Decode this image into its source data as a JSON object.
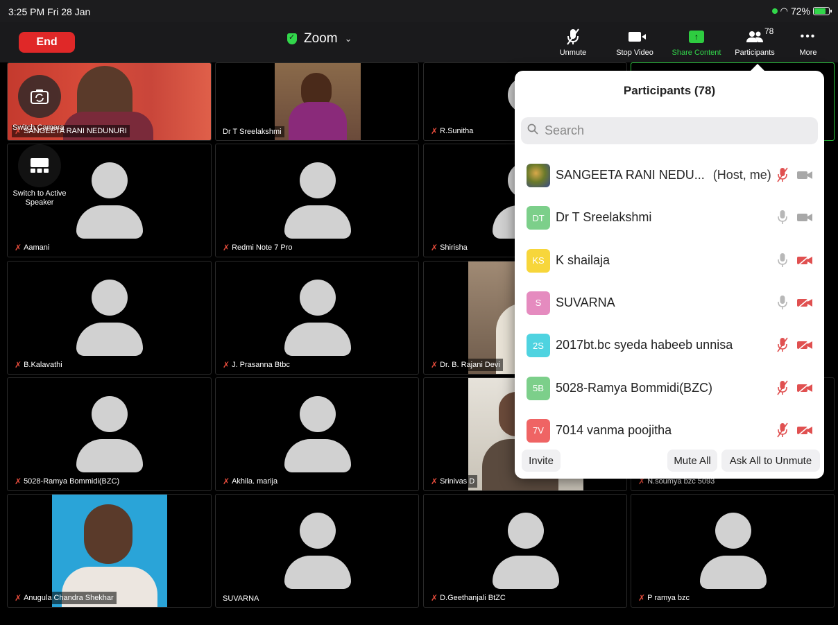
{
  "status_bar": {
    "time": "3:25 PM  Fri 28 Jan",
    "battery": "72%"
  },
  "toolbar": {
    "end_label": "End",
    "meeting_title": "Zoom",
    "unmute_label": "Unmute",
    "stop_video_label": "Stop Video",
    "share_label": "Share Content",
    "participants_label": "Participants",
    "participants_count": "78",
    "more_label": "More"
  },
  "controls": {
    "switch_camera_label": "Switch Camera",
    "switch_speaker_label": "Switch to Active Speaker"
  },
  "tiles": [
    "SANGEETA RANI NEDUNURI",
    "Dr T Sreelakshmi",
    "R.Sunitha",
    "Aamani",
    "Redmi Note 7 Pro",
    "Shirisha",
    "B.Kalavathi",
    "J. Prasanna Btbc",
    "Dr. B. Rajani Devi",
    "5028-Ramya Bommidi(BZC)",
    "Akhila. marija",
    "Srinivas D",
    "N.soumya bzc 5093",
    "Anugula Chandra Shekhar",
    "SUVARNA",
    "D.Geethanjali BtZC",
    "P ramya bzc"
  ],
  "panel": {
    "title": "Participants (78)",
    "search_placeholder": "Search",
    "participants": [
      {
        "initials": "",
        "name": "SANGEETA RANI NEDU...",
        "tag": "(Host, me)",
        "avatar_color": "#8a6d2f",
        "mic_muted": true,
        "cam_off": false
      },
      {
        "initials": "DT",
        "name": "Dr T Sreelakshmi",
        "tag": "",
        "avatar_color": "#7ccf8a",
        "mic_muted": false,
        "cam_off": false
      },
      {
        "initials": "KS",
        "name": "K shailaja",
        "tag": "",
        "avatar_color": "#f7d63b",
        "mic_muted": false,
        "cam_off": true
      },
      {
        "initials": "S",
        "name": "SUVARNA",
        "tag": "",
        "avatar_color": "#e58bbf",
        "mic_muted": false,
        "cam_off": true
      },
      {
        "initials": "2S",
        "name": "2017bt.bc syeda habeeb unnisa",
        "tag": "",
        "avatar_color": "#4fd3e0",
        "mic_muted": true,
        "cam_off": true
      },
      {
        "initials": "5B",
        "name": "5028-Ramya Bommidi(BZC)",
        "tag": "",
        "avatar_color": "#7ccf8a",
        "mic_muted": true,
        "cam_off": true
      },
      {
        "initials": "7V",
        "name": "7014 vanma poojitha",
        "tag": "",
        "avatar_color": "#ef6464",
        "mic_muted": true,
        "cam_off": true
      }
    ],
    "invite_label": "Invite",
    "mute_all_label": "Mute All",
    "ask_all_label": "Ask All to Unmute"
  }
}
